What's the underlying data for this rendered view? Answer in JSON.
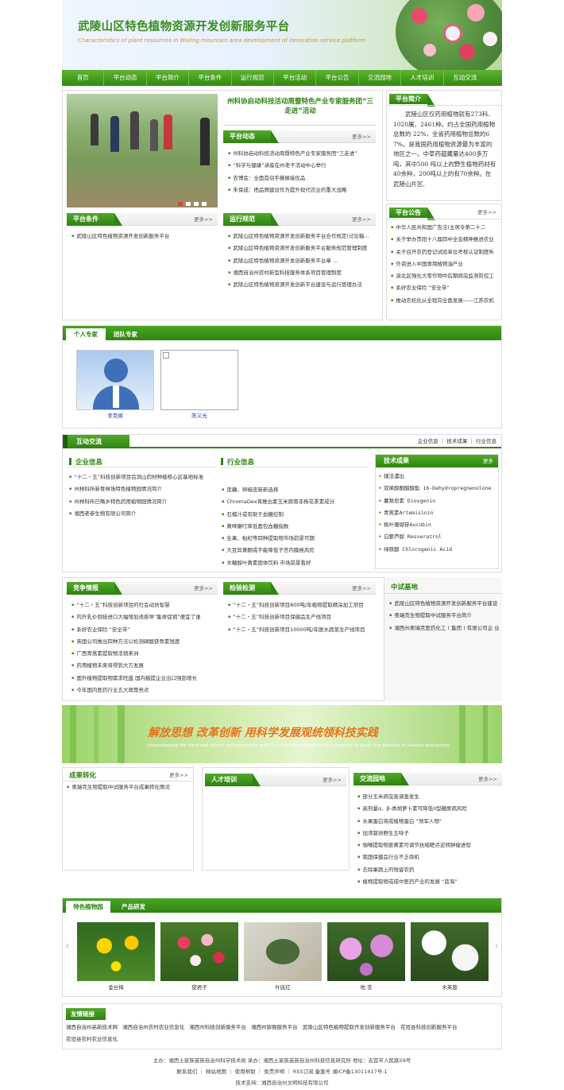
{
  "banner": {
    "title": "武陵山区特色植物资源开发创新服务平台",
    "subtitle": "Characteristics of plant resources in Wuling mountain area development of innovation service platform"
  },
  "nav": [
    "首页",
    "平台动态",
    "平台简介",
    "平台条件",
    "运行规范",
    "平台活动",
    "平台公告",
    "交流园地",
    "人才培训",
    "互动交流"
  ],
  "news": {
    "headline": "州科协启动科技活动周暨特色产业专家服务团“三走进”活动"
  },
  "dynamic": {
    "title": "平台动态",
    "more": "更多>>",
    "items": [
      "州科协启动科技活动周暨特色产业专家服务团“三走进”",
      "“科学与健康”讲座在州老干活动中心举行",
      "农博会：全面首创手藤嫁接优品",
      "朱保成：把品牌建设作为提升现代农业的重大战略"
    ]
  },
  "intro": {
    "title": "平台简介",
    "text": "武陵山区仅药用植物就有273科、1020属、2461种。约占全国药用植物总数的 22%，全省药用植物总数的67%。是我国药用植物资源最为丰富的地区之一。中草药蕴藏量达400多万吨，其中500 吨以上的野生植物药材有40余种，200吨以上的有70余种。在武陵山片区,"
  },
  "conditions": {
    "title": "平台条件",
    "more": "更多>>",
    "items": [
      "武陵山区特色植物资源开发创新服务平台"
    ]
  },
  "rules": {
    "title": "运行规范",
    "more": "更多>>",
    "items": [
      "武陵山区特色植物资源开发创新服务平台合作规定(讨论稿…",
      "武陵山区特色植物资源开发创新服务平台服务规范管理制度",
      "武陵山区特色植物资源开发创新服务平台章 …",
      "湘西自治州农村新型科技服务体系项目管理制度",
      "武陵山区特色植物资源开发创新平台建设与运行管理办法"
    ]
  },
  "notice": {
    "title": "平台公告",
    "more": "更多>>",
    "items": [
      "中华人民共和国广告法(主席令第二十二",
      "关于举办贵阳十八届四中全会精神推进农业",
      "关于召开农药登记试验单位考核认证制度听",
      "外资进入中国食用植物油产业",
      "渝北区强化大零作物中后期病虫监测防控工",
      "系好农业保险 “安全带”",
      "推动农机化从全程向全面发展——江苏农机"
    ]
  },
  "experts": {
    "tab_on": "个人专家",
    "tab_off": "团队专家",
    "people": [
      "李克纲",
      "陈义光"
    ]
  },
  "interact": {
    "title": "互动交流",
    "links": [
      "企业信息",
      "技术成果",
      "行业信息"
    ]
  },
  "enterprise": {
    "title": "企业信息",
    "items": [
      "“十二・五”科技创新项目吕洞山药材种植核心区基地标准",
      "州林科所新育林场特色植物园情况简介",
      "州林科所已略乡特色药用植物园情况简介",
      "湘西老参生物有限公司简介"
    ]
  },
  "industry": {
    "title": "行业信息",
    "items": [
      "莲藕，辨椒皮新新选择",
      "ChromaDex将推出紫玉米原南非杨花茶素成分",
      "石榴汁或有助于血糖控制",
      "黄啤嫩叮降低面包血糖指数",
      "生果、柏杞等四种提取物市场前景可期",
      "大豆异黄酮或不能降低子宫内膜癌风险",
      "木糖醇叶黄素固体饮料 市场前景看好"
    ]
  },
  "tech": {
    "title": "技术成果",
    "more": "更多",
    "items": [
      "辅洁濃出",
      "双烯醇酮醋酸酯 16-Dehydropregnenolone",
      "薯蓣皂素 Diosgenin",
      "青蒿素Artemisinin",
      "桃叶珊瑚苷Aucubin",
      "白藜芦醇 Resveratrol",
      "绿原酸 Chlorogenic Acid"
    ]
  },
  "compete": {
    "title": "竞争情报",
    "more": "更多>>",
    "items": [
      "“十二・五”科技创新项目的社会动员智慧",
      "内外乳价倒挂进口大幅增加诱惑导“集体促销”便宜了谁",
      "系好农业保险 “安全带”",
      "英国公司推出四种方法以检测磷酸铁骨素残度",
      "广西青蒿素提取物活销来洲",
      "药用植物未来将得到大方发展",
      "国外植物提取物需求旺盛 国内植提企业出口强劲增长",
      "今年国内医药行业五大政策亮点"
    ]
  },
  "testing": {
    "title": "检验检测",
    "more": "更多>>",
    "items": [
      "“十二・五”科技创新项目800吨/年植物提取精深加工项目",
      "“十二・五”科技创新项目保健品生产线项目",
      "“十二・五”科技创新项目10000吨/年脱水蔬菜生产线项目"
    ]
  },
  "pilot": {
    "title": "中试基地",
    "items": [
      "武陵山区特色植物资源开发创新服务平台建设",
      "奥瑞克生物提取中试服务平台简介",
      "湘西州奥瑞克医药化工 ( 集团 ) 有限公司企 业"
    ]
  },
  "slogan": {
    "title": "解放思想 改革创新 用科学发展观统领科技实践",
    "subtitle": "Emancipating the mind and reform and innovation with the scientific outlook on development to guide the practice of science and technology"
  },
  "achievement": {
    "title": "成果转化",
    "more": "更多>>",
    "items": [
      "奥瑞克生物提取中试服务平台成果转化情况"
    ]
  },
  "training": {
    "title": "人才培训",
    "more": "更多>>"
  },
  "exchange": {
    "title": "交流园地",
    "more": "更多>>",
    "items": [
      "部分玉米病虫害调查发生",
      "高剂量α、β-类胡萝卜素可降低II型糖尿病风险",
      "水果蛋白将成植物蛋白 “领军人物”",
      "加湾栽培野生五味子",
      "咖喱提取物姜黄素可调节抗缩靶点逆转肿瘤进程",
      "我国保健品行业不乏商机",
      "去除果蔬上的残留农药",
      "植物提取物或成中医药产业的发展 “蓝海”"
    ]
  },
  "gallery": {
    "tab_on": "特色植物园",
    "tab_off": "产品研发",
    "items": [
      "金丝梅",
      "使君子",
      "叶底红",
      "地 菍",
      "木芙蓉"
    ]
  },
  "friends": {
    "title": "友情链接",
    "links": [
      "湘西自治州高新技术网",
      "湘西自治州农村农业信息化",
      "湘西州科技创新服务平台",
      "湘西州猕猴服务平台",
      "武陵山区特色植物提取开发创新服务平台",
      "花垣县科技创新服务平台",
      "花垣县农村农业信息化"
    ]
  },
  "footer": {
    "line1": "主办：湘西土家族苗族自治州科学技术局 承办：湘西土家族苗族自治州科技信息研究所 地址：吉首市人民路59号",
    "line2": "联系我们 ｜ 网站地图 ｜ 使用帮助 ｜ 免责声明 ｜ RSS订阅 备案号 湘ICP备13011417号-1",
    "line3": "技术支持：湘西自治州文明科技有限公司"
  },
  "colors": {
    "brand": "#2e8510",
    "accent": "#e98a1a"
  }
}
